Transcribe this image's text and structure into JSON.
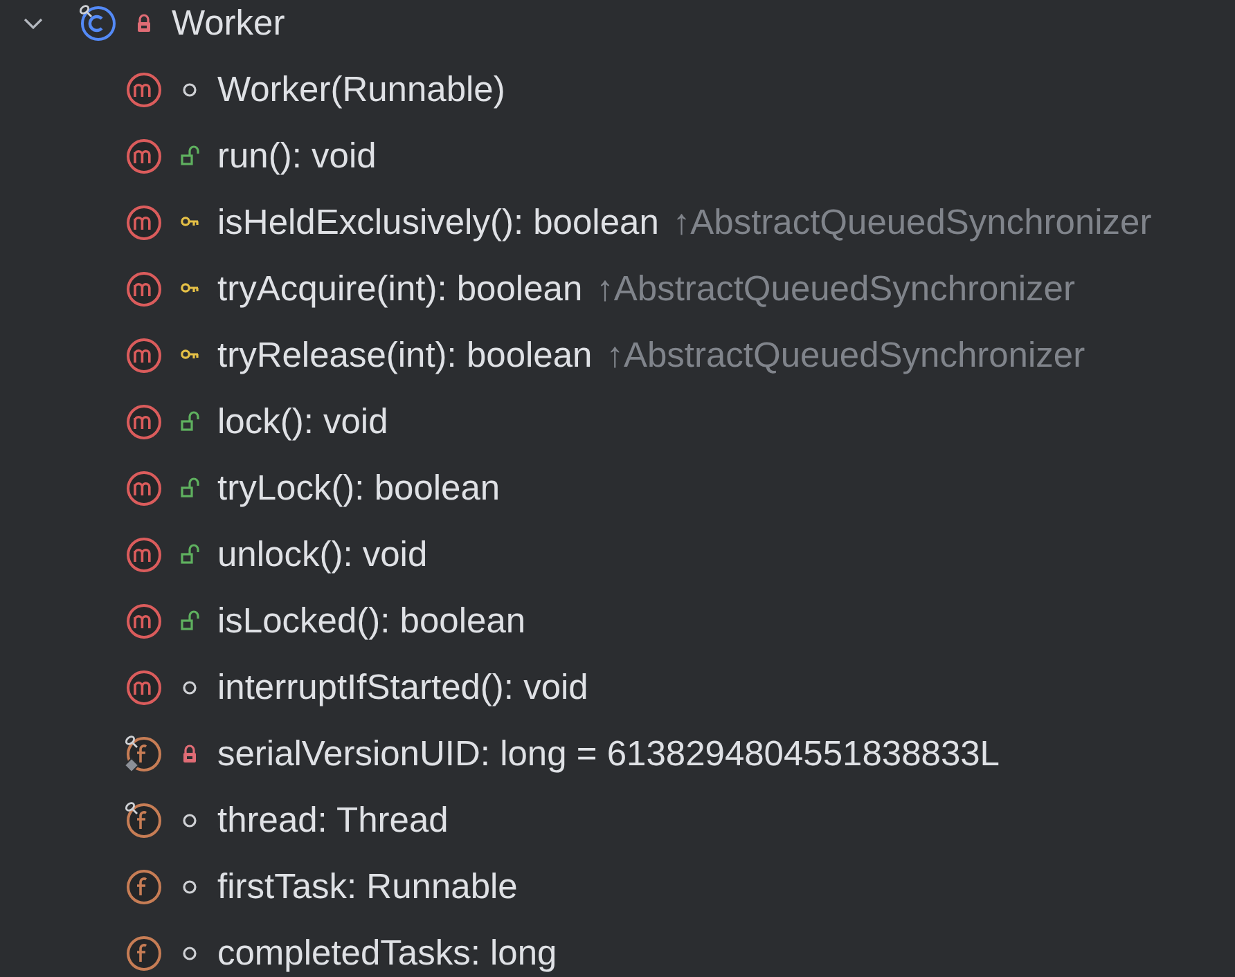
{
  "tree": {
    "label": "Worker",
    "kind": "class",
    "access": {
      "kind": "private"
    },
    "pinned": true,
    "static": false,
    "expanded": true,
    "children": [
      {
        "kind": "method",
        "access": {
          "kind": "package"
        },
        "pinned": false,
        "static": false,
        "label": "Worker(Runnable)"
      },
      {
        "kind": "method",
        "access": {
          "kind": "public"
        },
        "pinned": false,
        "static": false,
        "label": "run(): void"
      },
      {
        "kind": "method",
        "access": {
          "kind": "protected"
        },
        "pinned": false,
        "static": false,
        "label": "isHeldExclusively(): boolean",
        "origin": "↑AbstractQueuedSynchronizer"
      },
      {
        "kind": "method",
        "access": {
          "kind": "protected"
        },
        "pinned": false,
        "static": false,
        "label": "tryAcquire(int): boolean",
        "origin": "↑AbstractQueuedSynchronizer"
      },
      {
        "kind": "method",
        "access": {
          "kind": "protected"
        },
        "pinned": false,
        "static": false,
        "label": "tryRelease(int): boolean",
        "origin": "↑AbstractQueuedSynchronizer"
      },
      {
        "kind": "method",
        "access": {
          "kind": "public"
        },
        "pinned": false,
        "static": false,
        "label": "lock(): void"
      },
      {
        "kind": "method",
        "access": {
          "kind": "public"
        },
        "pinned": false,
        "static": false,
        "label": "tryLock(): boolean"
      },
      {
        "kind": "method",
        "access": {
          "kind": "public"
        },
        "pinned": false,
        "static": false,
        "label": "unlock(): void"
      },
      {
        "kind": "method",
        "access": {
          "kind": "public"
        },
        "pinned": false,
        "static": false,
        "label": "isLocked(): boolean"
      },
      {
        "kind": "method",
        "access": {
          "kind": "package"
        },
        "pinned": false,
        "static": false,
        "label": "interruptIfStarted(): void"
      },
      {
        "kind": "field",
        "access": {
          "kind": "private"
        },
        "pinned": true,
        "static": true,
        "label": "serialVersionUID: long = 6138294804551838833L"
      },
      {
        "kind": "field",
        "access": {
          "kind": "package"
        },
        "pinned": true,
        "static": false,
        "label": "thread: Thread"
      },
      {
        "kind": "field",
        "access": {
          "kind": "package"
        },
        "pinned": false,
        "static": false,
        "label": "firstTask: Runnable"
      },
      {
        "kind": "field",
        "access": {
          "kind": "package"
        },
        "pinned": false,
        "static": false,
        "label": "completedTasks: long"
      }
    ]
  }
}
